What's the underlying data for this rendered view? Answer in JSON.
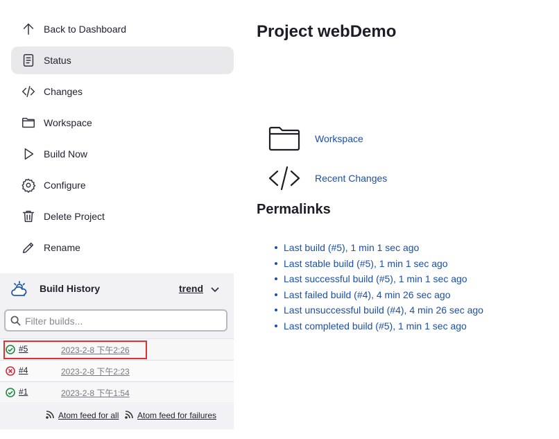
{
  "sidebar": {
    "tasks": [
      {
        "label": "Back to Dashboard",
        "icon": "arrow-up-icon"
      },
      {
        "label": "Status",
        "icon": "document-icon",
        "active": true
      },
      {
        "label": "Changes",
        "icon": "code-icon"
      },
      {
        "label": "Workspace",
        "icon": "folder-icon"
      },
      {
        "label": "Build Now",
        "icon": "play-icon"
      },
      {
        "label": "Configure",
        "icon": "gear-icon"
      },
      {
        "label": "Delete Project",
        "icon": "trash-icon"
      },
      {
        "label": "Rename",
        "icon": "pencil-icon"
      }
    ]
  },
  "build_history": {
    "title": "Build History",
    "trend_label": "trend",
    "filter_placeholder": "Filter builds...",
    "builds": [
      {
        "number": "#5",
        "time": "2023-2-8 下午2:26",
        "status": "success"
      },
      {
        "number": "#4",
        "time": "2023-2-8 下午2:23",
        "status": "failed"
      },
      {
        "number": "#1",
        "time": "2023-2-8 下午1:54",
        "status": "success"
      }
    ],
    "feed_all": "Atom feed for all",
    "feed_failures": "Atom feed for failures"
  },
  "main": {
    "title": "Project webDemo",
    "links": [
      {
        "label": "Workspace",
        "icon": "folder-icon"
      },
      {
        "label": "Recent Changes",
        "icon": "code-icon"
      }
    ],
    "permalinks_title": "Permalinks",
    "permalinks": [
      "Last build (#5), 1 min 1 sec ago",
      "Last stable build (#5), 1 min 1 sec ago",
      "Last successful build (#5), 1 min 1 sec ago",
      "Last failed build (#4), 4 min 26 sec ago",
      "Last unsuccessful build (#4), 4 min 26 sec ago",
      "Last completed build (#5), 1 min 1 sec ago"
    ]
  },
  "colors": {
    "link": "#1a4faa",
    "success": "#1e8a3e",
    "failure": "#d0283c",
    "active_bg": "#e9e9ec",
    "highlight": "#e03030"
  }
}
